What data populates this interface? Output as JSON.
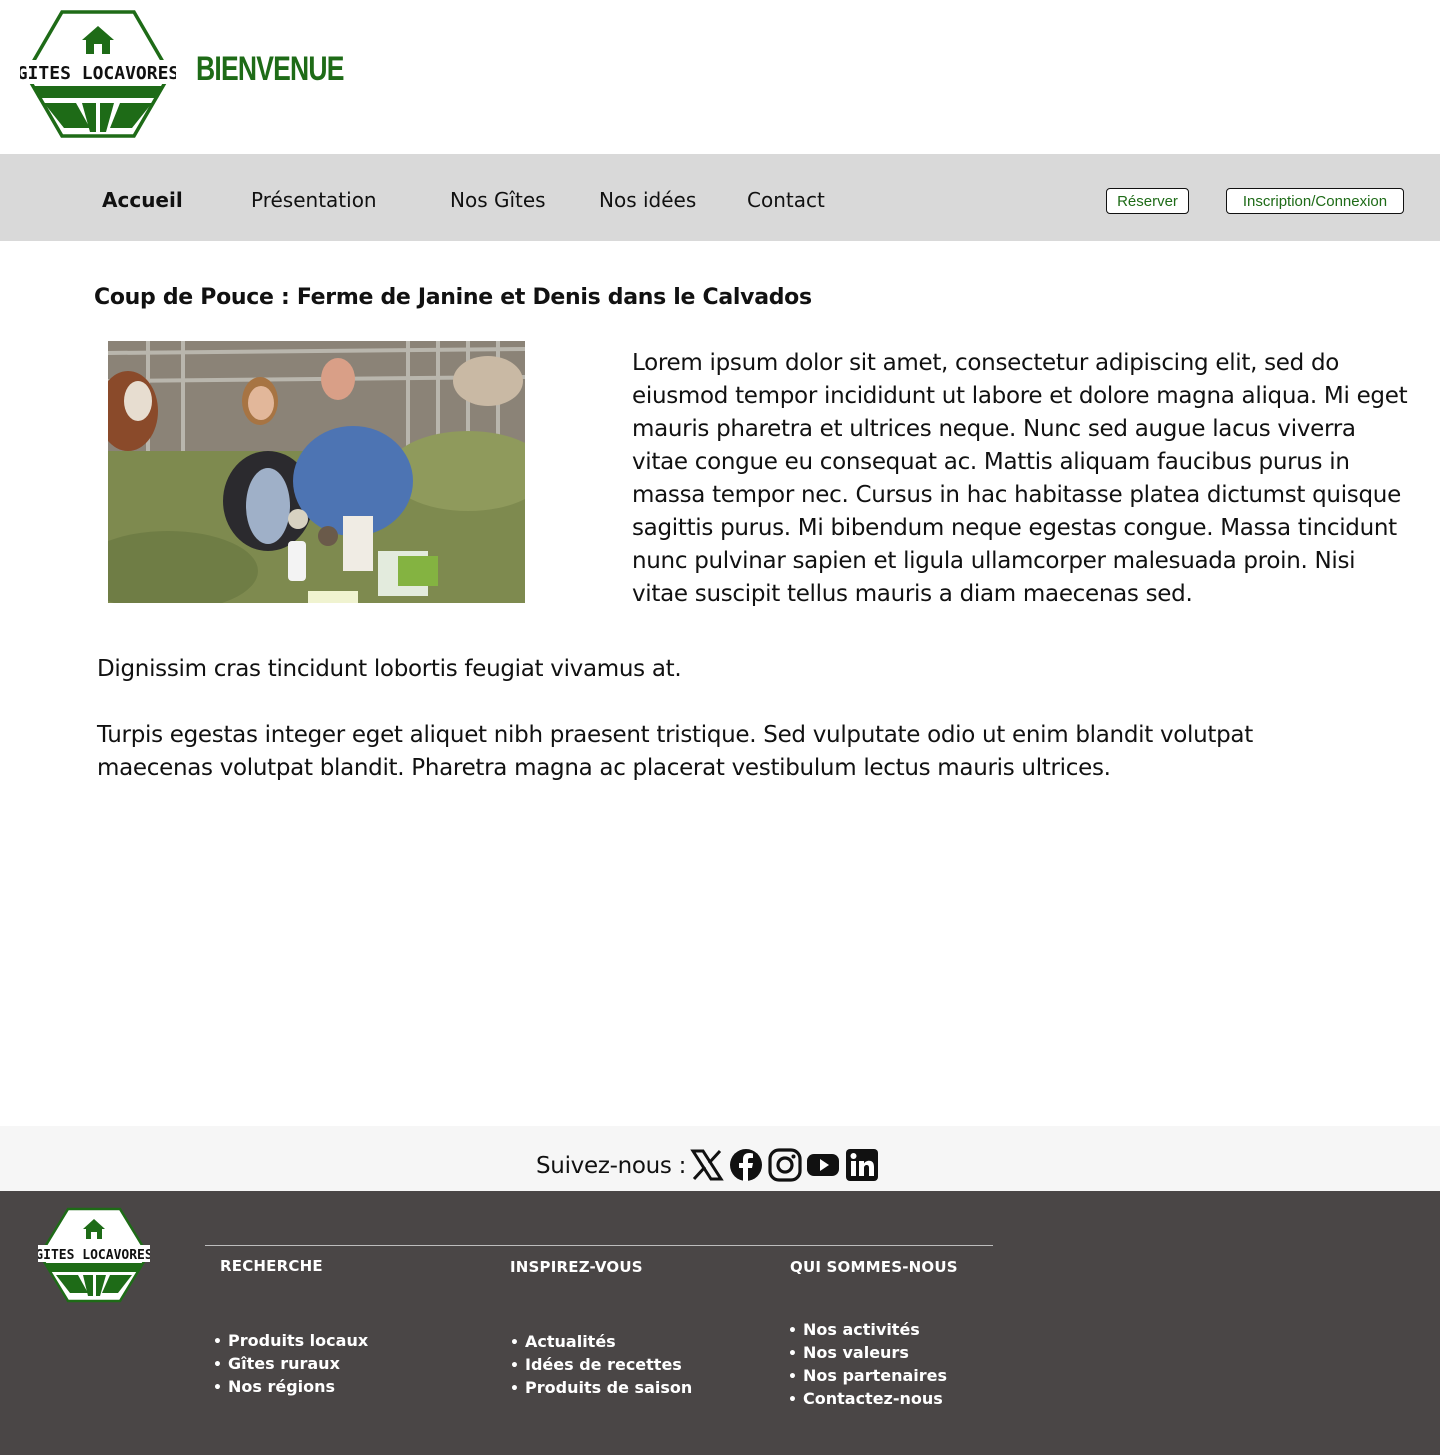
{
  "header": {
    "logo_text": "GITES LOCAVORES",
    "welcome": "BIENVENUE"
  },
  "nav": {
    "items": [
      {
        "label": "Accueil",
        "active": true
      },
      {
        "label": "Présentation"
      },
      {
        "label": "Nos Gîtes"
      },
      {
        "label": "Nos idées"
      },
      {
        "label": "Contact"
      }
    ],
    "reserve_label": "Réserver",
    "login_label": "Inscription/Connexion"
  },
  "article": {
    "title": "Coup de Pouce : Ferme de Janine et Denis dans le Calvados",
    "paragraph_1": "Lorem ipsum dolor sit amet, consectetur adipiscing elit, sed do eiusmod tempor incididunt ut labore et dolore magna aliqua. Mi eget mauris pharetra et ultrices neque. Nunc sed augue lacus viverra vitae congue eu consequat ac. Mattis aliquam faucibus purus in massa tempor nec. Cursus in hac habitasse platea dictumst quisque sagittis purus. Mi bibendum neque egestas congue. Massa tincidunt nunc pulvinar sapien et ligula ullamcorper malesuada proin. Nisi vitae suscipit tellus mauris a diam maecenas sed.",
    "paragraph_2": "Dignissim cras tincidunt lobortis feugiat vivamus at.",
    "paragraph_3": "Turpis egestas integer eget aliquet nibh praesent tristique. Sed vulputate odio ut enim blandit volutpat maecenas volutpat blandit. Pharetra magna ac placerat vestibulum lectus mauris ultrices."
  },
  "social": {
    "label": "Suivez-nous :",
    "icons": [
      "x-icon",
      "facebook-icon",
      "instagram-icon",
      "youtube-icon",
      "linkedin-icon"
    ]
  },
  "footer": {
    "logo_text": "GITES LOCAVORES",
    "columns": [
      {
        "heading": "RECHERCHE",
        "links": [
          "Produits locaux",
          "Gîtes ruraux",
          "Nos régions"
        ]
      },
      {
        "heading": "INSPIREZ-VOUS",
        "links": [
          "Actualités",
          "Idées de recettes",
          "Produits de saison"
        ]
      },
      {
        "heading": "QUI SOMMES-NOUS",
        "links": [
          "Nos activités",
          "Nos valeurs",
          "Nos partenaires",
          "Contactez-nous"
        ]
      }
    ]
  },
  "colors": {
    "brand_green": "#1e6b17",
    "nav_bg": "#d9d9d9",
    "footer_bg": "#4a4646"
  }
}
